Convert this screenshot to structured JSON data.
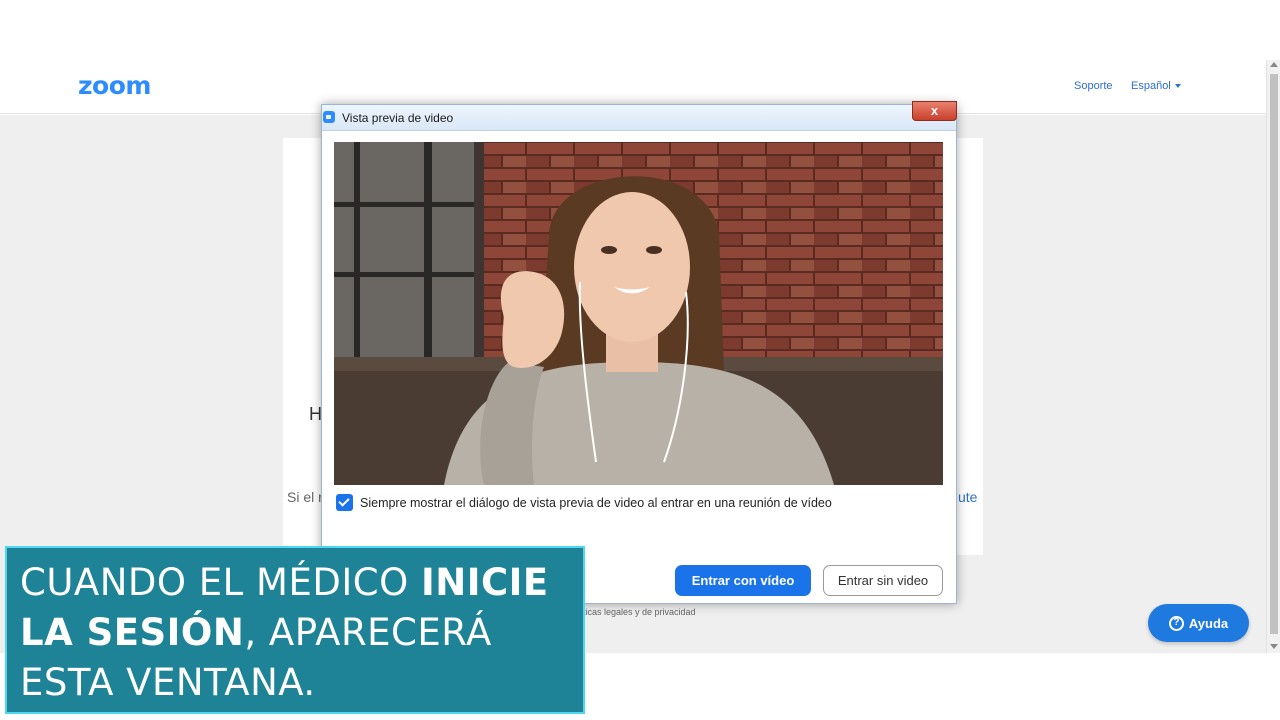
{
  "site": {
    "logo": "zoom",
    "nav_support": "Soporte",
    "nav_language": "Español",
    "partial_heading": "H",
    "partial_text_left": "Si el r",
    "partial_text_right": "ute",
    "footer_legal": "ticas legales y de privacidad",
    "help_label": "Ayuda",
    "help_glyph": "?"
  },
  "dialog": {
    "title": "Vista previa de video",
    "close_label": "x",
    "always_show_label": "Siempre mostrar el diálogo de vista previa de video al entrar en una reunión de vídeo",
    "always_show_checked": true,
    "join_with_video": "Entrar con vídeo",
    "join_without_video": "Entrar sin video"
  },
  "caption": {
    "line1_normal": "CUANDO EL MÉDICO ",
    "line1_bold": "INICIE",
    "line2_bold": "LA SESIÓN",
    "line2_normal": ", APARECERÁ",
    "line3_normal": "ESTA VENTANA."
  },
  "colors": {
    "zoom_blue": "#2d8cff",
    "button_blue": "#1a73e8",
    "caption_teal": "#1f8398",
    "caption_border": "#4fd7ef"
  },
  "icons": [
    "zoom-logo",
    "caret-down-icon",
    "help-icon",
    "video-camera-icon",
    "close-icon",
    "checkbox-checked-icon"
  ]
}
